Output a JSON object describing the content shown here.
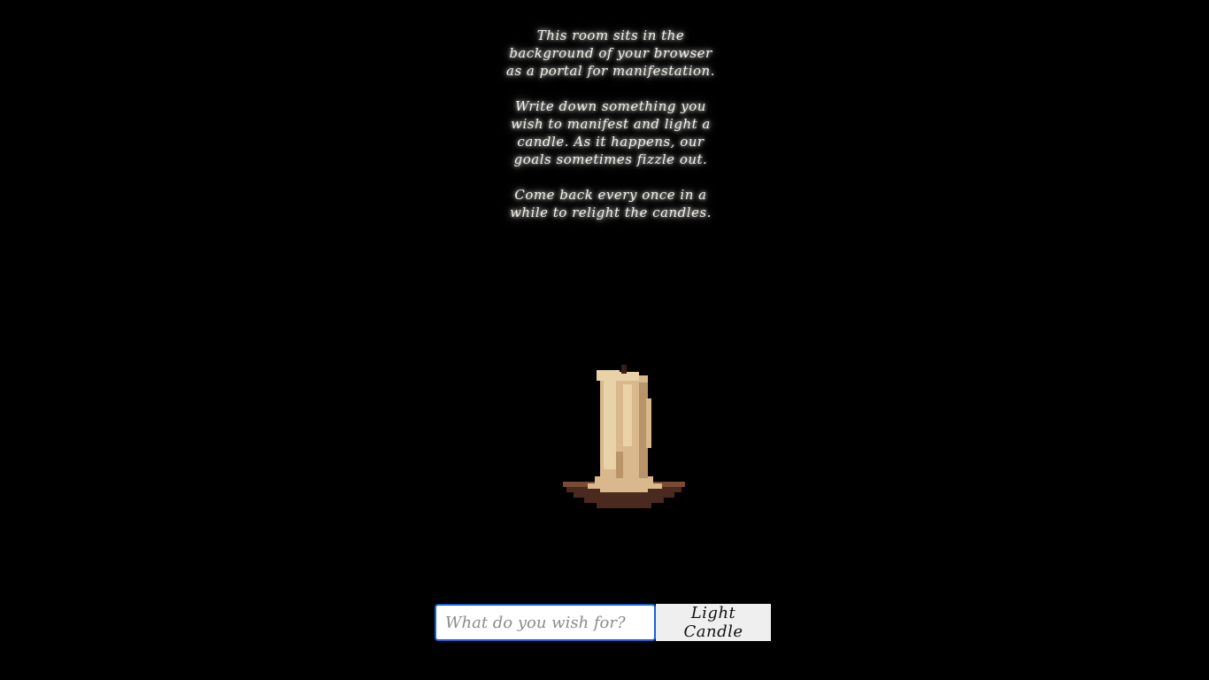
{
  "intro": {
    "paragraphs": [
      {
        "lines": [
          "This room sits in the",
          "background of your browser",
          "as a portal for manifestation."
        ]
      },
      {
        "lines": [
          "Write down something you",
          "wish to manifest and light a",
          "candle. As it happens, our",
          "goals sometimes fizzle out."
        ]
      },
      {
        "lines": [
          "Come back every once in a",
          "while to relight the candles."
        ]
      }
    ]
  },
  "candle": {
    "state": "unlit",
    "wax_color": "#d8b88c",
    "wax_highlight": "#ead2a8",
    "wax_shadow": "#b89468",
    "holder_color": "#4a2a1e",
    "holder_highlight": "#7a4a32",
    "wick_color": "#3a1e14"
  },
  "wish_form": {
    "input_value": "",
    "input_placeholder": "What do you wish for?",
    "button_label": "Light Candle"
  },
  "colors": {
    "background": "#000000",
    "text": "#f4f1ea",
    "input_border": "#1a5fd6",
    "button_bg": "#efefef"
  }
}
